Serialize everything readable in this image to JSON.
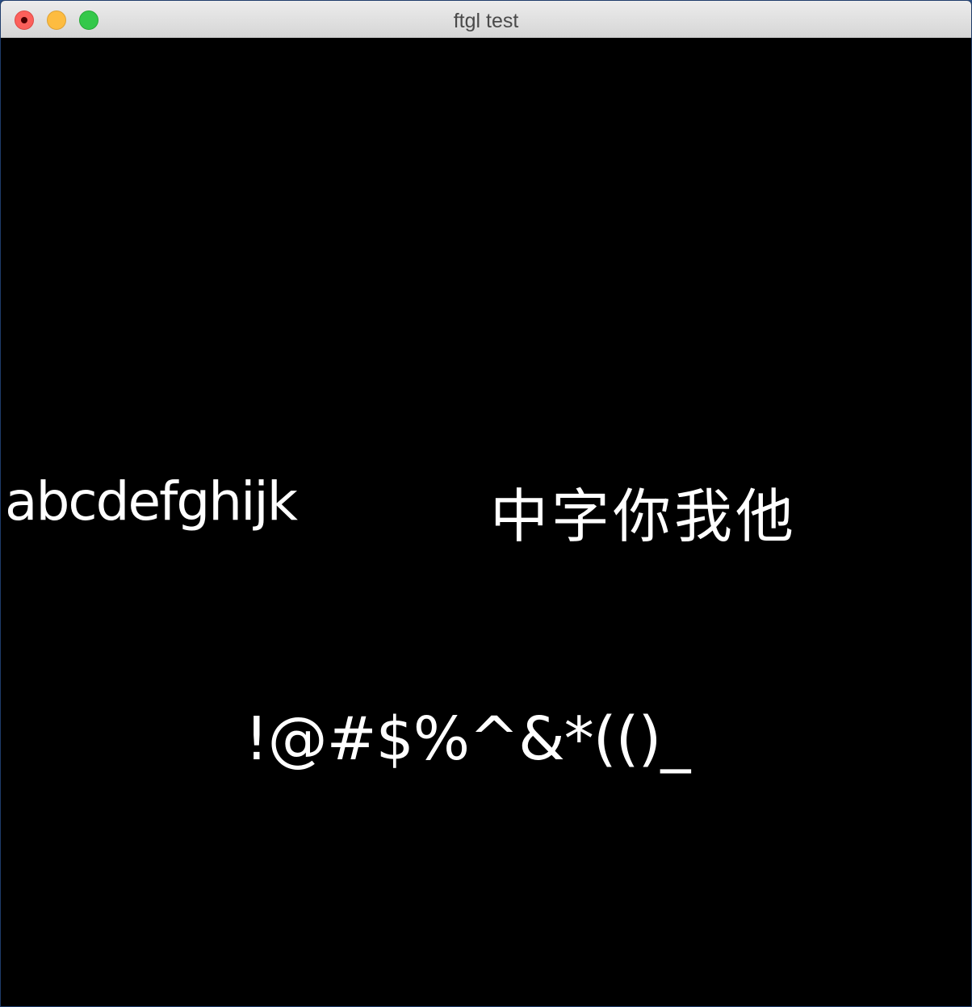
{
  "window": {
    "title": "ftgl test"
  },
  "canvas": {
    "background": "#000000",
    "text_color": "#ffffff",
    "lines": {
      "latin": "abcdefghijk",
      "cjk": "中字你我他",
      "symbols": "!@#$%^&*(()_"
    }
  },
  "icons": {
    "close": "close-icon",
    "minimize": "minimize-icon",
    "maximize": "maximize-icon"
  },
  "colors": {
    "close": "#fc605b",
    "minimize": "#fdbc40",
    "maximize": "#34c84a"
  }
}
